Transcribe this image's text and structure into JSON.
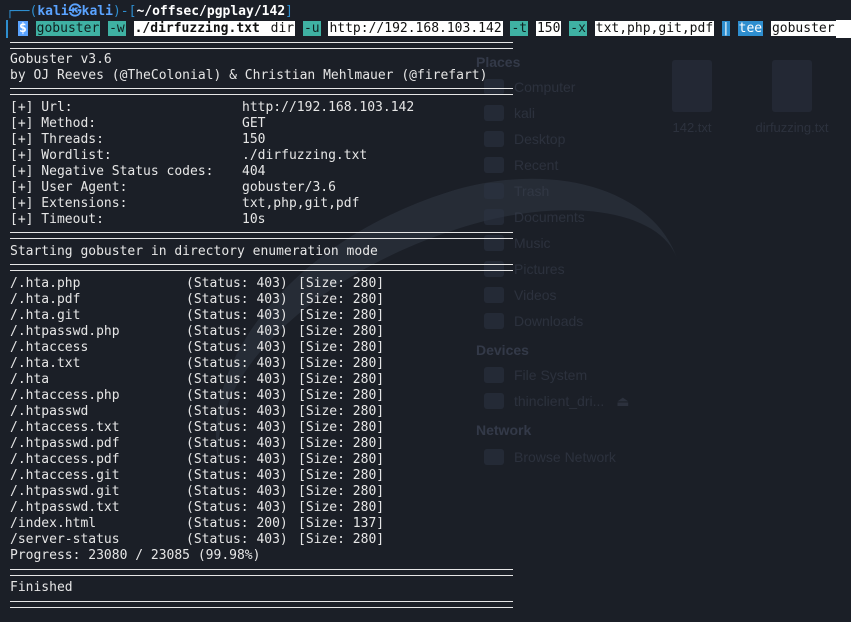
{
  "background": {
    "places_header": "Places",
    "places": [
      "Computer",
      "kali",
      "Desktop",
      "Recent",
      "Trash",
      "Documents",
      "Music",
      "Pictures",
      "Videos",
      "Downloads"
    ],
    "devices_header": "Devices",
    "devices": [
      "File System",
      "thinclient_dri..."
    ],
    "network_header": "Network",
    "network": [
      "Browse Network"
    ],
    "files": [
      "142.txt",
      "dirfuzzing.txt"
    ]
  },
  "prompt": {
    "corner": "┌──(",
    "user": "kali",
    "at": "㉿",
    "host": "kali",
    "mid": ")-[",
    "path": "~/offsec/pgplay/142",
    "end": "]"
  },
  "command": {
    "dollar": "$",
    "tool": "gobuster",
    "flag_w": "-w",
    "wordlist": "./dirfuzzing.txt",
    "mode": "dir",
    "flag_u": "-u",
    "url": "http://192.168.103.142",
    "flag_t": "-t",
    "threads": "150",
    "flag_x": "-x",
    "exts": "txt,php,git,pdf",
    "pipe": "|",
    "tee": "tee",
    "outfile": "gobuster"
  },
  "banner": [
    "Gobuster v3.6",
    "by OJ Reeves (@TheColonial) & Christian Mehlmauer (@firefart)"
  ],
  "config": [
    {
      "key": "[+] Url:",
      "value": "http://192.168.103.142"
    },
    {
      "key": "[+] Method:",
      "value": "GET"
    },
    {
      "key": "[+] Threads:",
      "value": "150"
    },
    {
      "key": "[+] Wordlist:",
      "value": "./dirfuzzing.txt"
    },
    {
      "key": "[+] Negative Status codes:",
      "value": "404"
    },
    {
      "key": "[+] User Agent:",
      "value": "gobuster/3.6"
    },
    {
      "key": "[+] Extensions:",
      "value": "txt,php,git,pdf"
    },
    {
      "key": "[+] Timeout:",
      "value": "10s"
    }
  ],
  "start_msg": "Starting gobuster in directory enumeration mode",
  "results": [
    {
      "path": "/.hta.php",
      "status": "(Status: 403)",
      "size": "[Size: 280]"
    },
    {
      "path": "/.hta.pdf",
      "status": "(Status: 403)",
      "size": "[Size: 280]"
    },
    {
      "path": "/.hta.git",
      "status": "(Status: 403)",
      "size": "[Size: 280]"
    },
    {
      "path": "/.htpasswd.php",
      "status": "(Status: 403)",
      "size": "[Size: 280]"
    },
    {
      "path": "/.htaccess",
      "status": "(Status: 403)",
      "size": "[Size: 280]"
    },
    {
      "path": "/.hta.txt",
      "status": "(Status: 403)",
      "size": "[Size: 280]"
    },
    {
      "path": "/.hta",
      "status": "(Status: 403)",
      "size": "[Size: 280]"
    },
    {
      "path": "/.htaccess.php",
      "status": "(Status: 403)",
      "size": "[Size: 280]"
    },
    {
      "path": "/.htpasswd",
      "status": "(Status: 403)",
      "size": "[Size: 280]"
    },
    {
      "path": "/.htaccess.txt",
      "status": "(Status: 403)",
      "size": "[Size: 280]"
    },
    {
      "path": "/.htpasswd.pdf",
      "status": "(Status: 403)",
      "size": "[Size: 280]"
    },
    {
      "path": "/.htaccess.pdf",
      "status": "(Status: 403)",
      "size": "[Size: 280]"
    },
    {
      "path": "/.htaccess.git",
      "status": "(Status: 403)",
      "size": "[Size: 280]"
    },
    {
      "path": "/.htpasswd.git",
      "status": "(Status: 403)",
      "size": "[Size: 280]"
    },
    {
      "path": "/.htpasswd.txt",
      "status": "(Status: 403)",
      "size": "[Size: 280]"
    },
    {
      "path": "/index.html",
      "status": "(Status: 200)",
      "size": "[Size: 137]"
    },
    {
      "path": "/server-status",
      "status": "(Status: 403)",
      "size": "[Size: 280]"
    }
  ],
  "progress": "Progress: 23080 / 23085 (99.98%)",
  "finished": "Finished"
}
